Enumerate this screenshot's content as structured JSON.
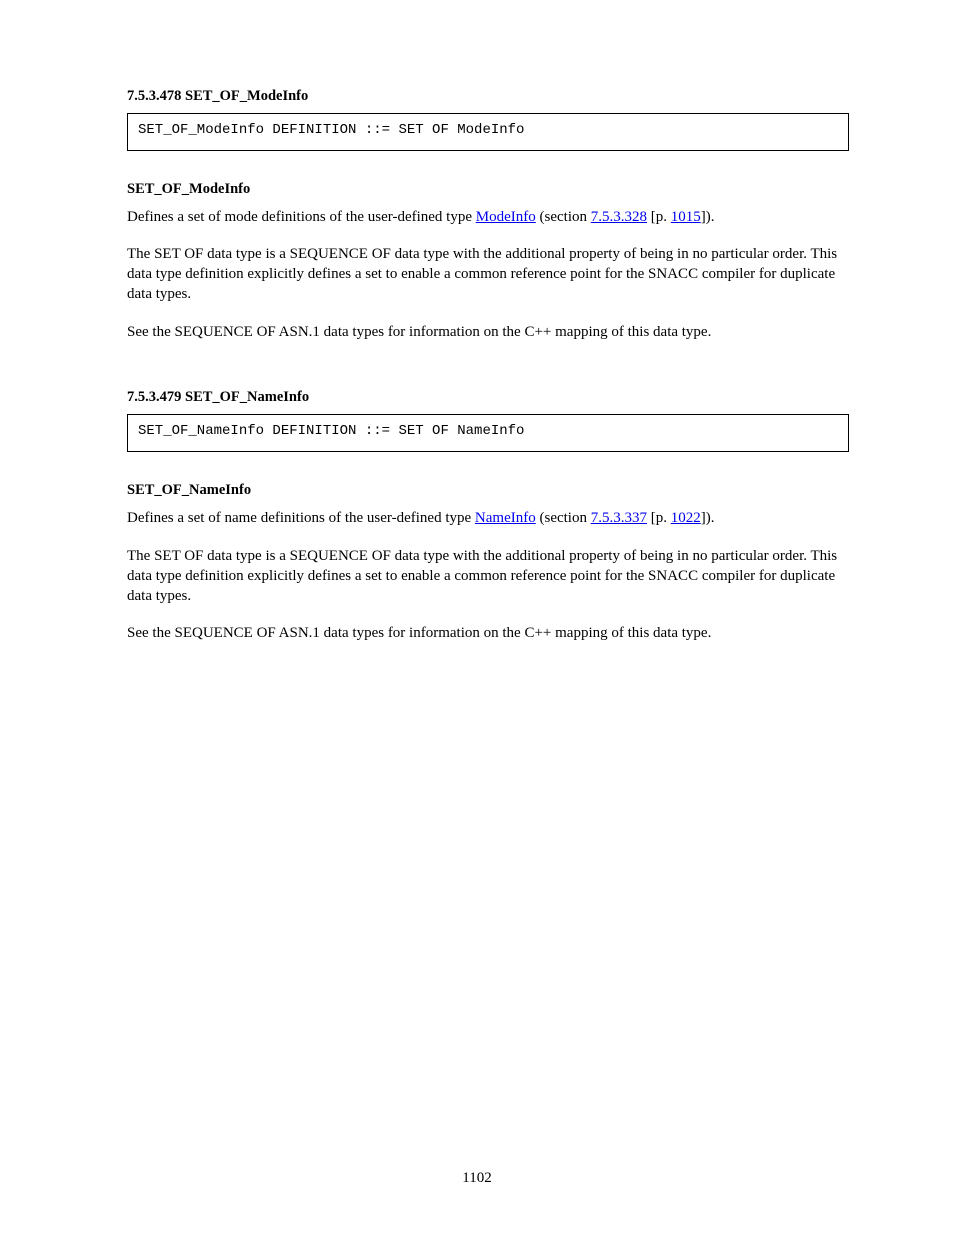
{
  "entries": [
    {
      "heading": "7.5.3.478 SET_OF_ModeInfo",
      "code": "SET_OF_ModeInfo DEFINITION ::= SET OF ModeInfo",
      "label": "SET_OF_ModeInfo",
      "para1": {
        "pre": "Defines a set of mode definitions of the user-defined type ",
        "link1_text": "ModeInfo",
        "mid": " (section ",
        "link2_text": "7.5.3.328",
        "mid2": " [p. ",
        "link3_text": "1015",
        "post": "])."
      },
      "para2": "The SET OF data type is a SEQUENCE OF data type with the additional property of being in no particular order. This data type definition explicitly defines a set to enable a common reference point for the SNACC compiler for duplicate data types.",
      "para3": "See the SEQUENCE OF ASN.1 data types for information on the C++ mapping of this data type."
    },
    {
      "heading": "7.5.3.479 SET_OF_NameInfo",
      "code": "SET_OF_NameInfo DEFINITION ::= SET OF NameInfo",
      "label": "SET_OF_NameInfo",
      "para1": {
        "pre": "Defines a set of name definitions of the user-defined type ",
        "link1_text": "NameInfo",
        "mid": " (section ",
        "link2_text": "7.5.3.337",
        "mid2": " [p. ",
        "link3_text": "1022",
        "post": "])."
      },
      "para2": "The SET OF data type is a SEQUENCE OF data type with the additional property of being in no particular order. This data type definition explicitly defines a set to enable a common reference point for the SNACC compiler for duplicate data types.",
      "para3": "See the SEQUENCE OF ASN.1 data types for information on the C++ mapping of this data type."
    }
  ],
  "page_number": "1102"
}
